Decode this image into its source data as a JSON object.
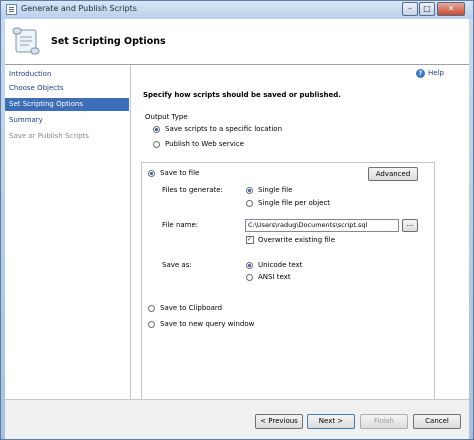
{
  "window": {
    "title": "Generate and Publish Scripts"
  },
  "header": {
    "title": "Set Scripting Options"
  },
  "nav": {
    "items": [
      {
        "label": "Introduction"
      },
      {
        "label": "Choose Objects"
      },
      {
        "label": "Set Scripting Options"
      },
      {
        "label": "Summary"
      },
      {
        "label": "Save or Publish Scripts"
      }
    ]
  },
  "main": {
    "help_label": "Help",
    "instruction": "Specify how scripts should be saved or published.",
    "output_type": {
      "label": "Output Type",
      "options": [
        {
          "label": "Save scripts to a specific location",
          "checked": true
        },
        {
          "label": "Publish to Web service",
          "checked": false
        }
      ]
    },
    "save_to_file": {
      "label": "Save to file",
      "advanced_label": "Advanced",
      "files_to_generate_label": "Files to generate:",
      "files_options": [
        {
          "label": "Single file",
          "checked": true
        },
        {
          "label": "Single file per object",
          "checked": false
        }
      ],
      "file_name_label": "File name:",
      "file_name_value": "C:\\Users\\radug\\Documents\\script.sql",
      "browse_label": "...",
      "overwrite_label": "Overwrite existing file",
      "save_as_label": "Save as:",
      "save_as_options": [
        {
          "label": "Unicode text",
          "checked": true
        },
        {
          "label": "ANSI text",
          "checked": false
        }
      ]
    },
    "save_to_clipboard_label": "Save to Clipboard",
    "save_to_query_window_label": "Save to new query window"
  },
  "footer": {
    "previous_label": "< Previous",
    "next_label": "Next >",
    "finish_label": "Finish",
    "cancel_label": "Cancel"
  }
}
